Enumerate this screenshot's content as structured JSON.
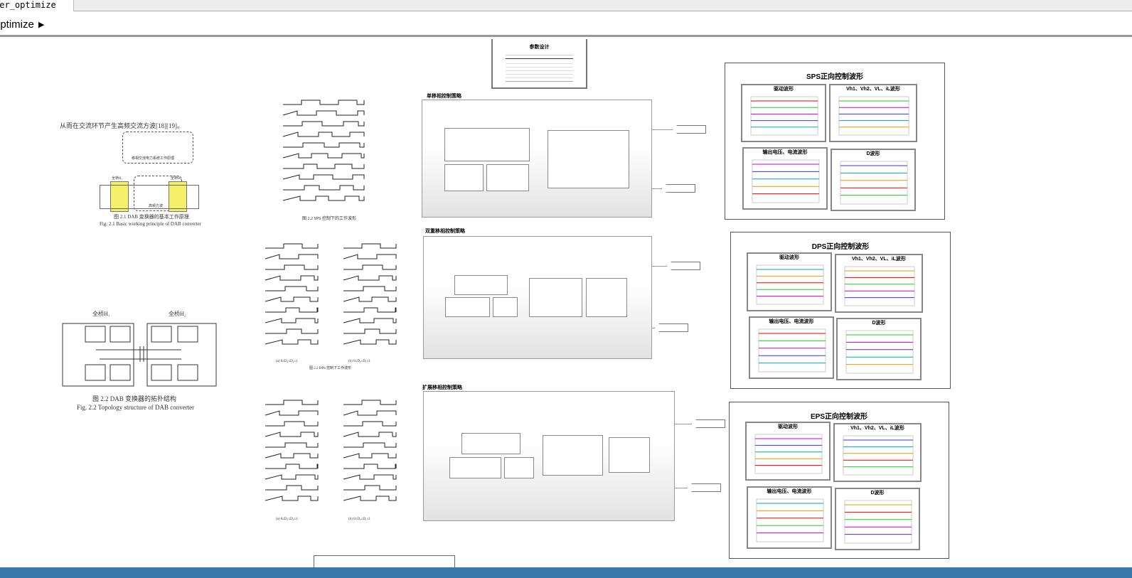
{
  "tab": {
    "label": "wer_optimize"
  },
  "breadcrumb": {
    "label": "optimize"
  },
  "docs": {
    "intro_text": "从而在交流环节产生高频交流方波[18][19]。",
    "fig21_cn": "图 2.1  DAB 变换器的基本工作原理",
    "fig21_en": "Fig. 2.1   Basic working principle of DAB converter",
    "fig21_bridge1": "全桥H₁",
    "fig21_bridge2": "全桥H₂",
    "fig21_box": "移相交流电力系统工作原理",
    "fig21_wave": "高频方波",
    "fig22_cn": "图 2.2   DAB 变换器的拓扑结构",
    "fig22_en": "Fig. 2.2    Topology structure of DAB converter",
    "fig22_bridge1": "全桥H₁",
    "fig22_bridge2": "全桥H₂",
    "fig23_cn": "图 2.2   SPS 控制下的工作波形",
    "dps_caption_a": "(a) 0≤D₁≤D₂≤1",
    "dps_caption_b": "(b) 0≤D₂≤D₁≤1",
    "dps_caption": "图 2.2   DPS 控制下工作波形",
    "eps_caption_a": "(a) 0≤D₁≤D₂≤1",
    "eps_caption_b": "(b) 0≤D₂≤D₁≤1"
  },
  "param_table": {
    "title": "参数设计"
  },
  "subsystems": [
    {
      "title": "单移相控制策略"
    },
    {
      "title": "双重移相控制策略"
    },
    {
      "title": "扩展移相控制策略"
    }
  ],
  "scopes": [
    {
      "title": "SPS正向控制波形",
      "panels": [
        "驱动波形",
        "Vh1、Vh2、VL、iL波形",
        "输出电压、电流波形",
        "D波形"
      ]
    },
    {
      "title": "DPS正向控制波形",
      "panels": [
        "驱动波形",
        "Vh1、Vh2、VL、iL波形",
        "输出电压、电流波形",
        "D波形"
      ]
    },
    {
      "title": "EPS正向控制波形",
      "panels": [
        "驱动波形",
        "Vh1、Vh2、VL、iL波形",
        "输出电压、电流波形",
        "D波形"
      ]
    }
  ],
  "colors": {
    "status_bar": "#3b79ac",
    "highlight": "#f5f06a"
  }
}
